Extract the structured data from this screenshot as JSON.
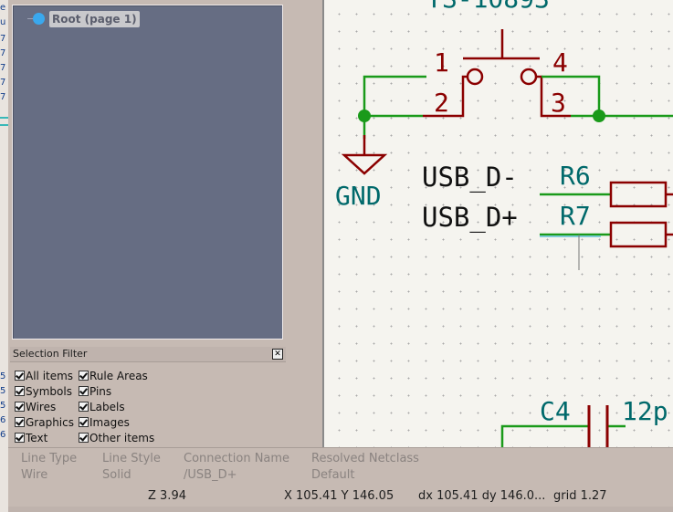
{
  "hierarchy": {
    "root_label": "Root (page 1)"
  },
  "selection_filter": {
    "title": "Selection Filter",
    "col1": [
      "All items",
      "Symbols",
      "Wires",
      "Graphics",
      "Text"
    ],
    "col2": [
      "Rule Areas",
      "Pins",
      "Labels",
      "Images",
      "Other items"
    ]
  },
  "schematic": {
    "switch_ref": "TS-10893",
    "pins": [
      "1",
      "2",
      "3",
      "4"
    ],
    "gnd_label": "GND",
    "net_usb_dm": "USB_D-",
    "net_usb_dp": "USB_D+",
    "r6": "R6",
    "r7": "R7",
    "c4": "C4",
    "c4_value": "12p",
    "colors": {
      "wire": "#1a9a1a",
      "symbol": "#8b0000",
      "label": "#00696b",
      "text": "#111111"
    }
  },
  "properties": {
    "line_type_label": "Line Type",
    "line_type_value": "Wire",
    "line_style_label": "Line Style",
    "line_style_value": "Solid",
    "connection_name_label": "Connection Name",
    "connection_name_value": "/USB_D+",
    "resolved_netclass_label": "Resolved Netclass",
    "resolved_netclass_value": "Default"
  },
  "statusbar": {
    "zoom": "Z 3.94",
    "coords": "X 105.41  Y 146.05",
    "delta": "dx 105.41  dy 146.0...",
    "grid": "grid 1.27"
  }
}
